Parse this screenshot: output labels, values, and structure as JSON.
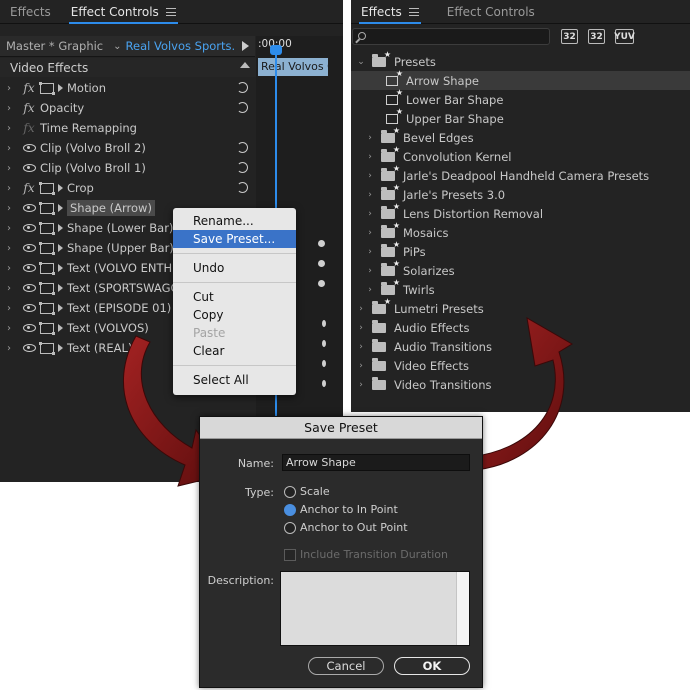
{
  "left_panel": {
    "tabs": [
      {
        "label": "Effects"
      },
      {
        "label": "Effect Controls"
      }
    ],
    "clip": {
      "master": "Master * Graphic",
      "sequence": "Real Volvos Sports..."
    },
    "timeline": {
      "time": ":00:00",
      "clip_label": "Real Volvos C"
    },
    "section_header": "Video Effects",
    "effects": [
      {
        "label": "Motion"
      },
      {
        "label": "Opacity"
      },
      {
        "label": "Time Remapping"
      },
      {
        "label": "Clip (Volvo Broll 2)"
      },
      {
        "label": "Clip (Volvo Broll 1)"
      },
      {
        "label": "Crop"
      },
      {
        "label": "Shape (Arrow)"
      },
      {
        "label": "Shape (Lower Bar)"
      },
      {
        "label": "Shape (Upper Bar)"
      },
      {
        "label": "Text (VOLVO ENTHU"
      },
      {
        "label": "Text (SPORTSWAGON"
      },
      {
        "label": "Text (EPISODE 01)"
      },
      {
        "label": "Text (VOLVOS)"
      },
      {
        "label": "Text (REAL)"
      }
    ]
  },
  "context_menu": {
    "items": [
      {
        "label": "Rename..."
      },
      {
        "label": "Save Preset..."
      },
      {
        "label": "Undo"
      },
      {
        "label": "Cut"
      },
      {
        "label": "Copy"
      },
      {
        "label": "Paste"
      },
      {
        "label": "Clear"
      },
      {
        "label": "Select All"
      }
    ]
  },
  "right_panel": {
    "tabs": [
      {
        "label": "Effects"
      },
      {
        "label": "Effect Controls"
      }
    ],
    "buttons": [
      {
        "label": "32"
      },
      {
        "label": "32"
      },
      {
        "label": "YUV"
      }
    ],
    "tree": [
      {
        "label": "Presets"
      },
      {
        "label": "Arrow Shape"
      },
      {
        "label": "Lower Bar Shape"
      },
      {
        "label": "Upper Bar Shape"
      },
      {
        "label": "Bevel Edges"
      },
      {
        "label": "Convolution Kernel"
      },
      {
        "label": "Jarle's Deadpool Handheld Camera Presets"
      },
      {
        "label": "Jarle's Presets 3.0"
      },
      {
        "label": "Lens Distortion Removal"
      },
      {
        "label": "Mosaics"
      },
      {
        "label": "PiPs"
      },
      {
        "label": "Solarizes"
      },
      {
        "label": "Twirls"
      },
      {
        "label": "Lumetri Presets"
      },
      {
        "label": "Audio Effects"
      },
      {
        "label": "Audio Transitions"
      },
      {
        "label": "Video Effects"
      },
      {
        "label": "Video Transitions"
      }
    ]
  },
  "dialog": {
    "title": "Save Preset",
    "name_label": "Name:",
    "name_value": "Arrow Shape",
    "type_label": "Type:",
    "options": [
      {
        "label": "Scale"
      },
      {
        "label": "Anchor to In Point"
      },
      {
        "label": "Anchor to Out Point"
      }
    ],
    "include_label": "Include Transition Duration",
    "description_label": "Description:",
    "cancel_label": "Cancel",
    "ok_label": "OK"
  },
  "colors": {
    "accent": "#2d8ceb",
    "arrow": "#8b1a1a"
  }
}
